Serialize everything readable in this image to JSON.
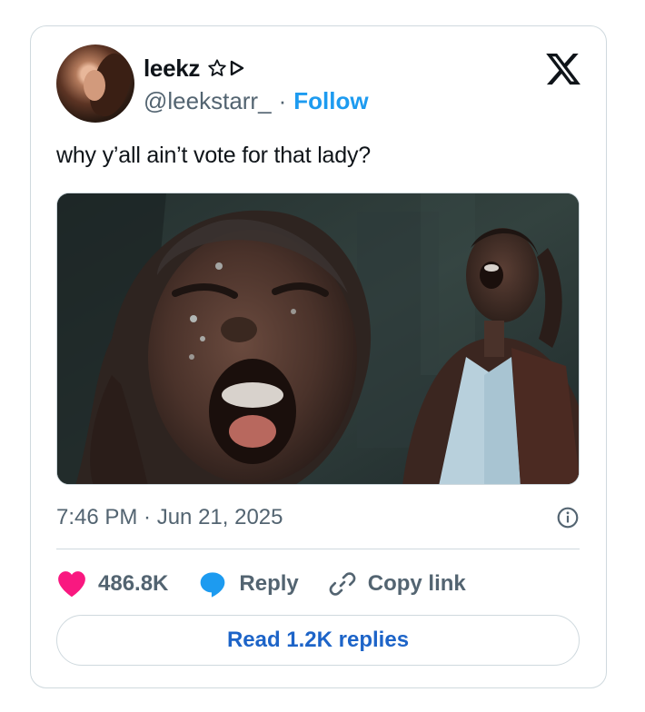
{
  "user": {
    "name": "leekz",
    "handle": "@leekstarr_",
    "separator": "·",
    "follow_label": "Follow"
  },
  "tweet": {
    "text": "why y’all ain’t vote for that lady?",
    "timestamp": "7:46 PM · Jun 21, 2025"
  },
  "actions": {
    "like_count": "486.8K",
    "reply_label": "Reply",
    "copy_label": "Copy link"
  },
  "read_replies_label": "Read 1.2K replies",
  "colors": {
    "like": "#f91880",
    "reply": "#1d9bf0",
    "link": "#1d64c8"
  }
}
